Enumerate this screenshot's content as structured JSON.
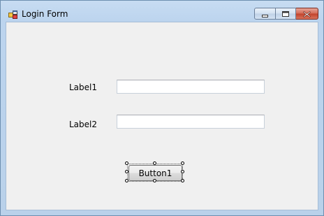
{
  "window": {
    "title": "Login Form",
    "icon": "form-app-icon",
    "controls": [
      "minimize-icon",
      "maximize-icon",
      "close-icon"
    ]
  },
  "form": {
    "label1": "Label1",
    "label2": "Label2",
    "textbox1_value": "",
    "textbox2_value": "",
    "button1": "Button1",
    "selected_control": "Button1"
  }
}
